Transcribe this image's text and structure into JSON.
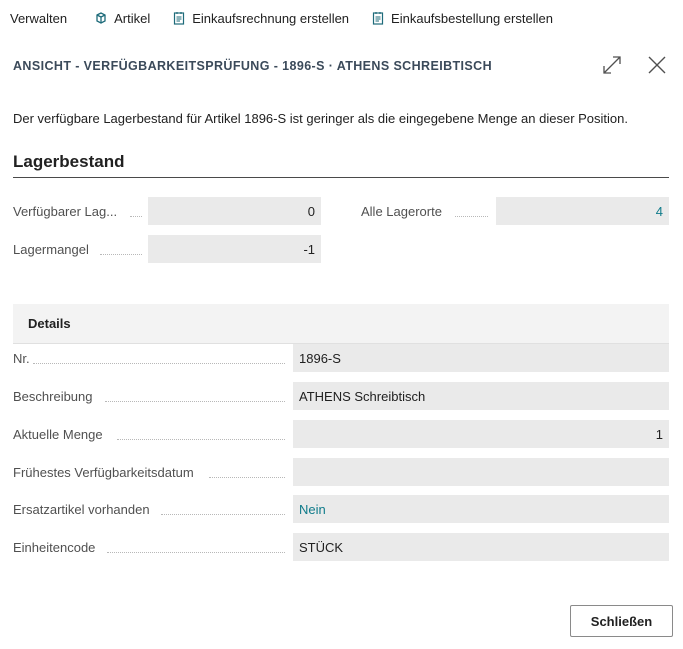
{
  "toolbar": {
    "manage_label": "Verwalten",
    "item_label": "Artikel",
    "purchase_invoice_label": "Einkaufsrechnung erstellen",
    "purchase_order_label": "Einkaufsbestellung erstellen"
  },
  "header": {
    "title": "ANSICHT - VERFÜGBARKEITSPRÜFUNG - 1896-S · ATHENS SCHREIBTISCH"
  },
  "message": "Der verfügbare Lagerbestand für Artikel 1896-S ist geringer als die eingegebene Menge an dieser Position.",
  "inventory": {
    "title": "Lagerbestand",
    "available_label": "Verfügbarer Lag...",
    "available_value": "0",
    "all_locations_label": "Alle Lagerorte",
    "all_locations_value": "4",
    "shortage_label": "Lagermangel",
    "shortage_value": "-1"
  },
  "details": {
    "title": "Details",
    "fields": [
      {
        "label": "Nr.",
        "value": "1896-S"
      },
      {
        "label": "Beschreibung",
        "value": "ATHENS Schreibtisch"
      },
      {
        "label": "Aktuelle Menge",
        "value": "1"
      },
      {
        "label": "Frühestes Verfügbarkeitsdatum",
        "value": ""
      },
      {
        "label": "Ersatzartikel vorhanden",
        "value": "Nein"
      },
      {
        "label": "Einheitencode",
        "value": "STÜCK"
      }
    ]
  },
  "footer": {
    "close_label": "Schließen"
  },
  "colors": {
    "link": "#0f7b8a",
    "field_bg": "#eaeaea",
    "icon": "#1e6b7a"
  }
}
